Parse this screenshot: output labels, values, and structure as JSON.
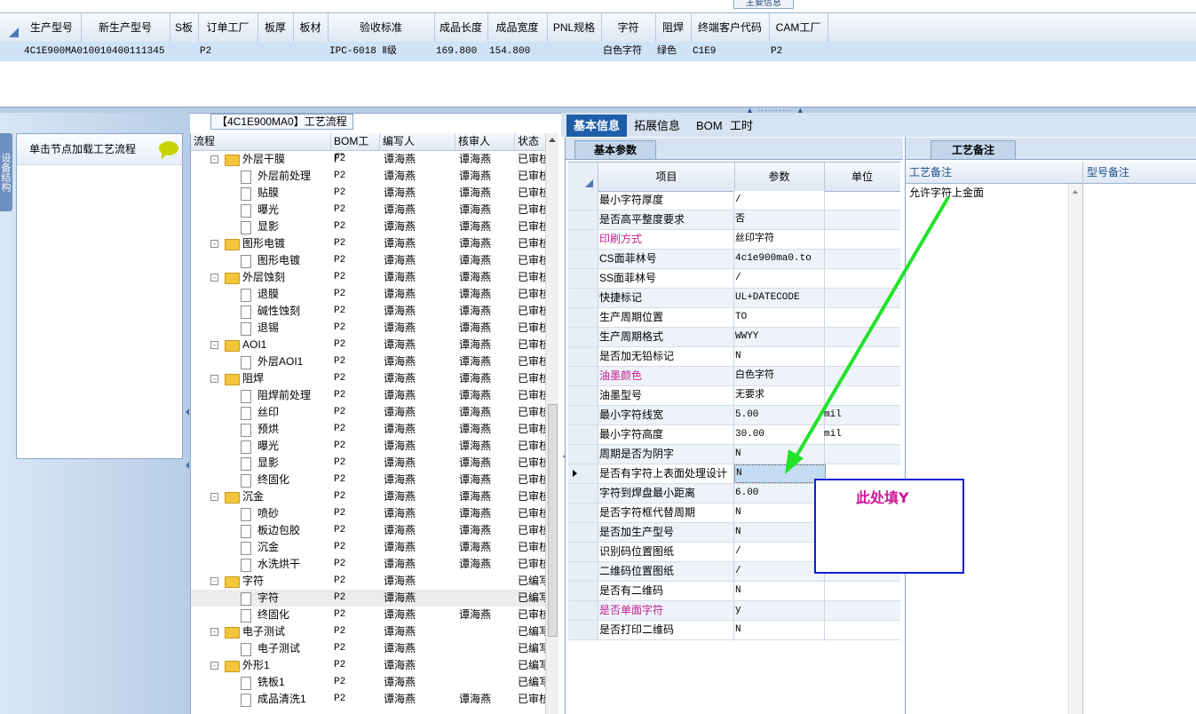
{
  "top_grid": {
    "tab_label": "主要信息",
    "columns": [
      "生产型号",
      "新生产型号",
      "S板",
      "订单工厂",
      "板厚",
      "板材",
      "验收标准",
      "成品长度",
      "成品宽度",
      "PNL规格",
      "字符",
      "阻焊",
      "终端客户代码",
      "CAM工厂"
    ],
    "row": [
      "4C1E900MA0",
      "10010400111345",
      "",
      "P2",
      "",
      "",
      "IPC-6018 Ⅱ级",
      "169.800",
      "154.800",
      "",
      "白色字符",
      "绿色",
      "C1E9",
      "P2"
    ]
  },
  "left_panel": {
    "side_tab": "设备结构",
    "node_hint": "单击节点加载工艺流程"
  },
  "process": {
    "title": "【4C1E900MA0】工艺流程",
    "columns": [
      "流程",
      "BOM工厂",
      "编写人",
      "核审人",
      "状态"
    ],
    "rows": [
      {
        "name": "外层干膜",
        "level": 0,
        "factory": "P2",
        "author": "谭海燕",
        "reviewer": "谭海燕",
        "status": "已审核"
      },
      {
        "name": "外层前处理",
        "level": 1,
        "factory": "P2",
        "author": "谭海燕",
        "reviewer": "谭海燕",
        "status": "已审核"
      },
      {
        "name": "贴膜",
        "level": 1,
        "factory": "P2",
        "author": "谭海燕",
        "reviewer": "谭海燕",
        "status": "已审核"
      },
      {
        "name": "曝光",
        "level": 1,
        "factory": "P2",
        "author": "谭海燕",
        "reviewer": "谭海燕",
        "status": "已审核"
      },
      {
        "name": "显影",
        "level": 1,
        "factory": "P2",
        "author": "谭海燕",
        "reviewer": "谭海燕",
        "status": "已审核"
      },
      {
        "name": "图形电镀",
        "level": 0,
        "factory": "P2",
        "author": "谭海燕",
        "reviewer": "谭海燕",
        "status": "已审核"
      },
      {
        "name": "图形电镀",
        "level": 1,
        "factory": "P2",
        "author": "谭海燕",
        "reviewer": "谭海燕",
        "status": "已审核"
      },
      {
        "name": "外层蚀刻",
        "level": 0,
        "factory": "P2",
        "author": "谭海燕",
        "reviewer": "谭海燕",
        "status": "已审核"
      },
      {
        "name": "退膜",
        "level": 1,
        "factory": "P2",
        "author": "谭海燕",
        "reviewer": "谭海燕",
        "status": "已审核"
      },
      {
        "name": "碱性蚀刻",
        "level": 1,
        "factory": "P2",
        "author": "谭海燕",
        "reviewer": "谭海燕",
        "status": "已审核"
      },
      {
        "name": "退锡",
        "level": 1,
        "factory": "P2",
        "author": "谭海燕",
        "reviewer": "谭海燕",
        "status": "已审核"
      },
      {
        "name": "AOI1",
        "level": 0,
        "factory": "P2",
        "author": "谭海燕",
        "reviewer": "谭海燕",
        "status": "已审核"
      },
      {
        "name": "外层AOI1",
        "level": 1,
        "factory": "P2",
        "author": "谭海燕",
        "reviewer": "谭海燕",
        "status": "已审核"
      },
      {
        "name": "阻焊",
        "level": 0,
        "factory": "P2",
        "author": "谭海燕",
        "reviewer": "谭海燕",
        "status": "已审核"
      },
      {
        "name": "阻焊前处理",
        "level": 1,
        "factory": "P2",
        "author": "谭海燕",
        "reviewer": "谭海燕",
        "status": "已审核"
      },
      {
        "name": "丝印",
        "level": 1,
        "factory": "P2",
        "author": "谭海燕",
        "reviewer": "谭海燕",
        "status": "已审核"
      },
      {
        "name": "预烘",
        "level": 1,
        "factory": "P2",
        "author": "谭海燕",
        "reviewer": "谭海燕",
        "status": "已审核"
      },
      {
        "name": "曝光",
        "level": 1,
        "factory": "P2",
        "author": "谭海燕",
        "reviewer": "谭海燕",
        "status": "已审核"
      },
      {
        "name": "显影",
        "level": 1,
        "factory": "P2",
        "author": "谭海燕",
        "reviewer": "谭海燕",
        "status": "已审核"
      },
      {
        "name": "终固化",
        "level": 1,
        "factory": "P2",
        "author": "谭海燕",
        "reviewer": "谭海燕",
        "status": "已审核"
      },
      {
        "name": "沉金",
        "level": 0,
        "factory": "P2",
        "author": "谭海燕",
        "reviewer": "谭海燕",
        "status": "已审核"
      },
      {
        "name": "喷砂",
        "level": 1,
        "factory": "P2",
        "author": "谭海燕",
        "reviewer": "谭海燕",
        "status": "已审核"
      },
      {
        "name": "板边包胶",
        "level": 1,
        "factory": "P2",
        "author": "谭海燕",
        "reviewer": "谭海燕",
        "status": "已审核"
      },
      {
        "name": "沉金",
        "level": 1,
        "factory": "P2",
        "author": "谭海燕",
        "reviewer": "谭海燕",
        "status": "已审核"
      },
      {
        "name": "水洗烘干",
        "level": 1,
        "factory": "P2",
        "author": "谭海燕",
        "reviewer": "谭海燕",
        "status": "已审核"
      },
      {
        "name": "字符",
        "level": 0,
        "factory": "P2",
        "author": "谭海燕",
        "reviewer": "",
        "status": "已编写"
      },
      {
        "name": "字符",
        "level": 1,
        "factory": "P2",
        "author": "谭海燕",
        "reviewer": "",
        "status": "已编写",
        "selected": true
      },
      {
        "name": "终固化",
        "level": 1,
        "factory": "P2",
        "author": "谭海燕",
        "reviewer": "谭海燕",
        "status": "已审核"
      },
      {
        "name": "电子测试",
        "level": 0,
        "factory": "P2",
        "author": "谭海燕",
        "reviewer": "",
        "status": "已编写"
      },
      {
        "name": "电子测试",
        "level": 1,
        "factory": "P2",
        "author": "谭海燕",
        "reviewer": "",
        "status": "已编写"
      },
      {
        "name": "外形1",
        "level": 0,
        "factory": "P2",
        "author": "谭海燕",
        "reviewer": "",
        "status": "已编写"
      },
      {
        "name": "铣板1",
        "level": 1,
        "factory": "P2",
        "author": "谭海燕",
        "reviewer": "",
        "status": "已编写"
      },
      {
        "name": "成品清洗1",
        "level": 1,
        "factory": "P2",
        "author": "谭海燕",
        "reviewer": "谭海燕",
        "status": "已审核"
      }
    ]
  },
  "right_tabs": [
    "基本信息",
    "拓展信息",
    "BOM",
    "工时"
  ],
  "basic_params": {
    "subtab": "基本参数",
    "columns": [
      "项目",
      "参数",
      "单位"
    ],
    "rows": [
      {
        "item": "最小字符厚度",
        "value": "/",
        "unit": ""
      },
      {
        "item": "是否高平整度要求",
        "value": "否",
        "unit": ""
      },
      {
        "item": "印刷方式",
        "value": "丝印字符",
        "unit": "",
        "highlight": true
      },
      {
        "item": "CS面菲林号",
        "value": "4c1e900ma0.to",
        "unit": ""
      },
      {
        "item": "SS面菲林号",
        "value": "/",
        "unit": ""
      },
      {
        "item": "快捷标记",
        "value": "UL+DATECODE",
        "unit": ""
      },
      {
        "item": "生产周期位置",
        "value": "TO",
        "unit": ""
      },
      {
        "item": "生产周期格式",
        "value": "WWYY",
        "unit": ""
      },
      {
        "item": "是否加无铅标记",
        "value": "N",
        "unit": ""
      },
      {
        "item": "油墨颜色",
        "value": "白色字符",
        "unit": "",
        "highlight": true
      },
      {
        "item": "油墨型号",
        "value": "无要求",
        "unit": ""
      },
      {
        "item": "最小字符线宽",
        "value": "5.00",
        "unit": "mil"
      },
      {
        "item": "最小字符高度",
        "value": "30.00",
        "unit": "mil"
      },
      {
        "item": "周期是否为阴字",
        "value": "N",
        "unit": ""
      },
      {
        "item": "是否有字符上表面处理设计",
        "value": "N",
        "unit": "",
        "current": true
      },
      {
        "item": "字符到焊盘最小距离",
        "value": "6.00",
        "unit": ""
      },
      {
        "item": "是否字符框代替周期",
        "value": "N",
        "unit": ""
      },
      {
        "item": "是否加生产型号",
        "value": "N",
        "unit": ""
      },
      {
        "item": "识别码位置图纸",
        "value": "/",
        "unit": ""
      },
      {
        "item": "二维码位置图纸",
        "value": "/",
        "unit": ""
      },
      {
        "item": "是否有二维码",
        "value": "N",
        "unit": ""
      },
      {
        "item": "是否单面字符",
        "value": "y",
        "unit": "",
        "highlight": true
      },
      {
        "item": "是否打印二维码",
        "value": "N",
        "unit": ""
      }
    ]
  },
  "notes": {
    "subtab": "工艺备注",
    "process_note_header": "工艺备注",
    "model_note_header": "型号备注",
    "process_note_text": "允许字符上金面"
  },
  "annotation": {
    "callout_text": "此处填Y",
    "arrow_color": "#22e22a",
    "box_color": "#0a1fd6",
    "text_color": "#d0149a"
  }
}
